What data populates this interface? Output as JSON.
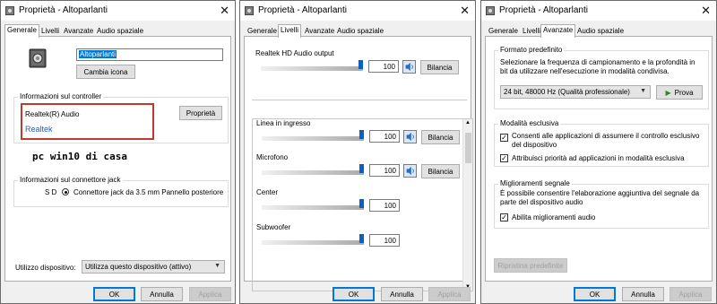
{
  "window_title": "Proprietà - Altoparlanti",
  "close_glyph": "✕",
  "tabs": [
    "Generale",
    "Livelli",
    "Avanzate",
    "Audio spaziale"
  ],
  "general": {
    "device_name": "Altoparlanti",
    "change_icon": "Cambia icona",
    "controller_group": "Informazioni sul controller",
    "controller_name": "Realtek(R) Audio",
    "properties_btn": "Proprietà",
    "vendor": "Realtek",
    "note": "pc win10 di casa",
    "jack_group": "Informazioni sul connettore jack",
    "jack_prefix": "S D",
    "jack_text": "Connettore jack da 3.5 mm Pannello posteriore",
    "usage_label": "Utilizzo dispositivo:",
    "usage_value": "Utilizza questo dispositivo (attivo)"
  },
  "levels": {
    "balance_label": "Bilancia",
    "items": [
      {
        "name": "Realtek HD Audio output",
        "value": "100"
      },
      {
        "name": "Linea in ingresso",
        "value": "100"
      },
      {
        "name": "Microfono",
        "value": "100"
      },
      {
        "name": "Center",
        "value": "100"
      },
      {
        "name": "Subwoofer",
        "value": "100"
      }
    ]
  },
  "advanced": {
    "format_group": "Formato predefinito",
    "format_desc": "Selezionare la frequenza di campionamento e la profondità in bit da utilizzare nell'esecuzione in modalità condivisa.",
    "format_value": "24 bit, 48000 Hz (Qualità professionale)",
    "test_btn": "Prova",
    "exclusive_group": "Modalità esclusiva",
    "exclusive_opt1": "Consenti alle applicazioni di assumere il controllo esclusivo del dispositivo",
    "exclusive_opt2": "Attribuisci priorità ad applicazioni in modalità esclusiva",
    "enhance_group": "Miglioramenti segnale",
    "enhance_desc": "È possibile consentire l'elaborazione aggiuntiva del segnale da parte del dispositivo audio",
    "enhance_opt": "Abilita miglioramenti audio",
    "restore_btn": "Ripristina predefinite"
  },
  "dialog": {
    "ok": "OK",
    "cancel": "Annulla",
    "apply": "Applica"
  },
  "colors": {
    "accent": "#0078d7",
    "highlight_box": "#c0392b",
    "vendor_link": "#2a5db0"
  }
}
